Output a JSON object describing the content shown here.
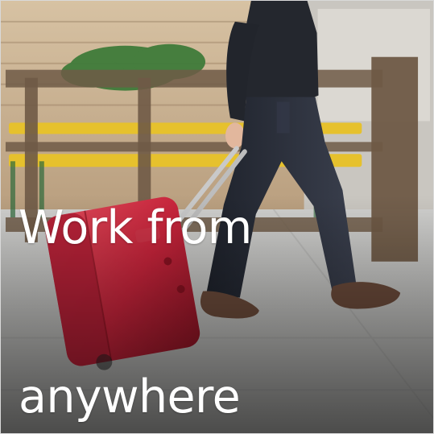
{
  "tile": {
    "caption_line1": "Work from",
    "caption_line2": "anywhere"
  },
  "colors": {
    "suitcase_red": "#c7243b",
    "bench_yellow": "#e6c12d",
    "rail_brown": "#6f5a46",
    "sidewalk_gray": "#b7b7b5",
    "jeans_dark": "#2b2f3b",
    "shoe_brown": "#6a4a3a"
  },
  "icons": {
    "scene": "person-walking-with-rolling-suitcase-illustration"
  }
}
